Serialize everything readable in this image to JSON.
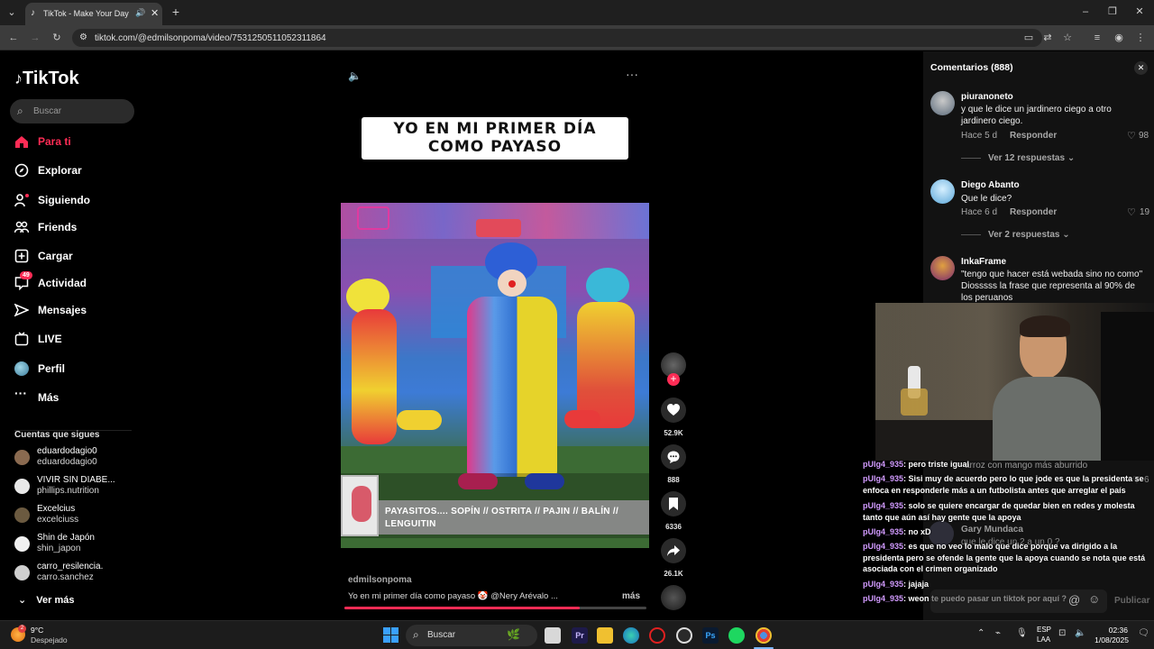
{
  "browser": {
    "tab_title": "TikTok - Make Your Day",
    "url": "tiktok.com/@edmilsonpoma/video/7531250511052311864"
  },
  "sidebar": {
    "logo": "TikTok",
    "search_placeholder": "Buscar",
    "nav": [
      {
        "label": "Para ti",
        "icon": "home-icon",
        "active": true
      },
      {
        "label": "Explorar",
        "icon": "compass-icon"
      },
      {
        "label": "Siguiendo",
        "icon": "following-icon"
      },
      {
        "label": "Friends",
        "icon": "friends-icon"
      },
      {
        "label": "Cargar",
        "icon": "upload-icon"
      },
      {
        "label": "Actividad",
        "icon": "activity-icon",
        "badge": "49"
      },
      {
        "label": "Mensajes",
        "icon": "messages-icon"
      },
      {
        "label": "LIVE",
        "icon": "live-icon"
      },
      {
        "label": "Perfil",
        "icon": "profile-icon"
      },
      {
        "label": "Más",
        "icon": "more-icon"
      }
    ],
    "following_title": "Cuentas que sigues",
    "following": [
      {
        "name": "eduardodagio0",
        "handle": "eduardodagio0"
      },
      {
        "name": "VIVIR SIN DIABE...",
        "handle": "phillips.nutrition"
      },
      {
        "name": "Excelcius",
        "handle": "excelciuss"
      },
      {
        "name": "Shin de Japón",
        "handle": "shin_japon"
      },
      {
        "name": "carro_resilencia.",
        "handle": "carro.sanchez"
      }
    ],
    "see_more": "Ver más"
  },
  "video": {
    "headline_line1": "YO EN MI PRIMER DÍA",
    "headline_line2": "COMO PAYASO",
    "caption_overlay": "PAYASITOS.... SOPÍN // OSTRITA // PAJIN // BALÍN // LENGUITIN",
    "author": "edmilsonpoma",
    "description": "Yo en mi primer día como payaso 🤡 @Nery Arévalo ...",
    "more_label": "más",
    "likes": "52.9K",
    "comments": "888",
    "saves": "6336",
    "shares": "26.1K"
  },
  "comments_panel": {
    "title": "Comentarios (888)",
    "comments": [
      {
        "user": "piuranoneto",
        "text": "y que le dice un jardinero ciego a otro jardinero ciego.",
        "time": "Hace 5 d",
        "reply": "Responder",
        "likes": "98",
        "more": "Ver 12 respuestas"
      },
      {
        "user": "Diego Abanto",
        "text": "Que le dice?",
        "time": "Hace 6 d",
        "reply": "Responder",
        "likes": "19",
        "more": "Ver 2 respuestas"
      },
      {
        "user": "InkaFrame",
        "text": "\"tengo que hacer está webada sino no como\" Diosssss la frase que representa al 90% de los peruanos",
        "time": "",
        "reply": "",
        "likes": "",
        "more": ""
      }
    ],
    "input_post_label": "Publicar"
  },
  "chat": [
    {
      "user": "pUlg4_935",
      "msg": ": pero triste igual"
    },
    {
      "user": "pUlg4_935",
      "msg": ": Sisi muy de acuerdo pero lo que jode es que la presidenta se enfoca en responderle más a un futbolista antes que arreglar el país"
    },
    {
      "user": "pUlg4_935",
      "msg": ": solo se quiere encargar de quedar bien en redes y molesta tanto que aún así hay gente que la apoya"
    },
    {
      "user": "pUlg4_935",
      "msg": ": no xD"
    },
    {
      "user": "pUlg4_935",
      "msg": ": es que no veo lo malo que dice porque va dirigido a la presidenta pero se ofende la gente que la apoya cuando se nota que está asociada con el crimen organizado"
    },
    {
      "user": "pUlg4_935",
      "msg": ": jajaja"
    },
    {
      "user": "pUlg4_935",
      "msg": ": weon te puedo pasar un tiktok por aquí ?"
    }
  ],
  "background_comment_fragments": {
    "frag1": "arroz con mango más aburrido",
    "frag2": "Gary Mundaca",
    "frag3": "que le dice un 2 a un 0 ?",
    "like6": "6"
  },
  "taskbar": {
    "weather_temp": "9°C",
    "weather_desc": "Despejado",
    "search_label": "Buscar",
    "lang1": "ESP",
    "lang2": "LAA",
    "time": "02:36",
    "date": "1/08/2025"
  },
  "colors": {
    "accent": "#fe2c55",
    "chat_user": "#d29bff"
  }
}
